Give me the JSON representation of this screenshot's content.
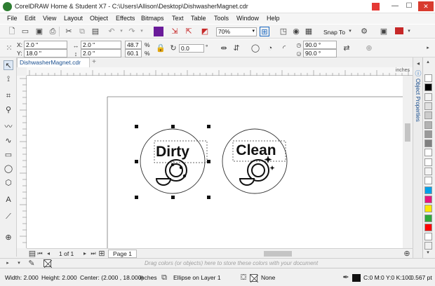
{
  "window": {
    "title": "CorelDRAW Home & Student X7 - C:\\Users\\Allison\\Desktop\\DishwasherMagnet.cdr",
    "minimize": "—",
    "maximize": "☐",
    "close": "✕"
  },
  "menu": [
    "File",
    "Edit",
    "View",
    "Layout",
    "Object",
    "Effects",
    "Bitmaps",
    "Text",
    "Table",
    "Tools",
    "Window",
    "Help"
  ],
  "standard_toolbar": {
    "zoom_value": "70%",
    "snap_to_label": "Snap To"
  },
  "property_bar": {
    "x_label": "X:",
    "x_value": "2.0 \"",
    "y_label": "Y:",
    "y_value": "18.0 \"",
    "width_value": "2.0 \"",
    "height_value": "2.0 \"",
    "scale_w": "48.7",
    "scale_h": "60.1",
    "pct": "%",
    "rotation_value": "0.0",
    "degree": "°",
    "start_angle": "90.0 °",
    "end_angle": "90.0 °"
  },
  "document_tab": {
    "label": "DishwasherMagnet.cdr",
    "add": "+"
  },
  "ruler": {
    "units": "inches"
  },
  "canvas": {
    "magnet_left_text": "Dirty",
    "magnet_right_text": "Clean"
  },
  "page_nav": {
    "page_count": "1 of 1",
    "page_tab": "Page 1"
  },
  "docker": {
    "label": "Object Properties"
  },
  "palette": {
    "colors": [
      "#ffffff",
      "#000000",
      "#f2f2f2",
      "#e0e0e0",
      "#cccccc",
      "#b3b3b3",
      "#999999",
      "#808080",
      "#ffffff",
      "#ffffff",
      "#f5f5f5",
      "#ffffff",
      "#00a0e8",
      "#e8157d",
      "#ffe600",
      "#2fa83c",
      "#ff0000",
      "#ffffff",
      "#f0f0f0"
    ]
  },
  "color_well": {
    "hint": "Drag colors (or objects) here to store these colors with your document"
  },
  "status": {
    "width": "Width: 2.000",
    "height": "Height: 2.000",
    "center": "Center: (2.000 , 18.000)",
    "units": "inches",
    "object": "Ellipse on Layer 1",
    "fill_none": "None",
    "outline": "C:0 M:0 Y:0 K:100",
    "outline_width": "0.567 pt"
  }
}
